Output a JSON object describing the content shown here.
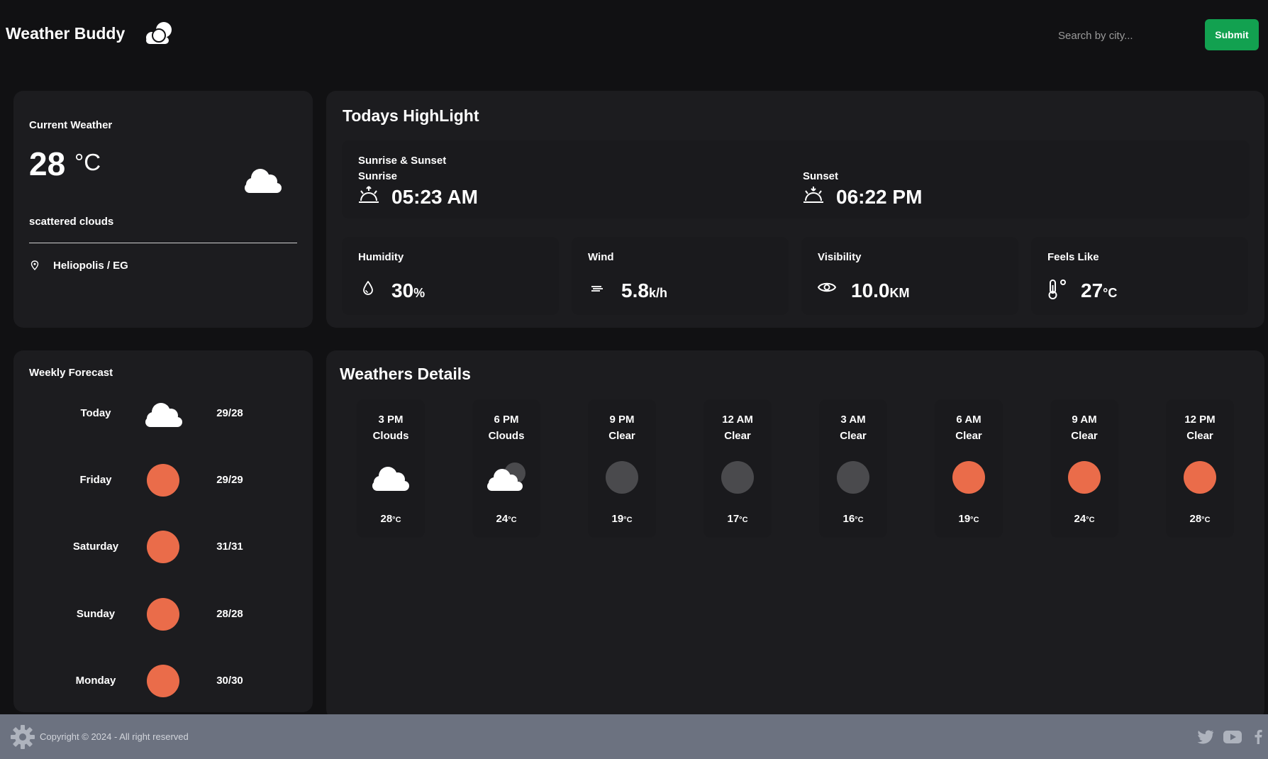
{
  "header": {
    "title": "Weather Buddy",
    "search_placeholder": "Search by city...",
    "search_value": "",
    "submit_label": "Submit"
  },
  "current": {
    "label": "Current Weather",
    "temp": "28",
    "unit": "°C",
    "description": "scattered clouds",
    "location": "Heliopolis / EG",
    "icon": "cloud-icon"
  },
  "highlights": {
    "title": "Todays HighLight",
    "sun_heading": "Sunrise & Sunset",
    "sunrise_label": "Sunrise",
    "sunrise_time": "05:23 AM",
    "sunset_label": "Sunset",
    "sunset_time": "06:22 PM",
    "humidity_label": "Humidity",
    "humidity_value": "30",
    "humidity_unit": "%",
    "wind_label": "Wind",
    "wind_value": "5.8",
    "wind_unit": "k/h",
    "visibility_label": "Visibility",
    "visibility_value": "10.0",
    "visibility_unit": "KM",
    "feels_label": "Feels Like",
    "feels_value": "27",
    "feels_unit": "°C"
  },
  "weekly": {
    "title": "Weekly Forecast",
    "days": [
      {
        "day": "Today",
        "temps": "29/28",
        "icon": "cloud-icon"
      },
      {
        "day": "Friday",
        "temps": "29/29",
        "icon": "sun-icon"
      },
      {
        "day": "Saturday",
        "temps": "31/31",
        "icon": "sun-icon"
      },
      {
        "day": "Sunday",
        "temps": "28/28",
        "icon": "sun-icon"
      },
      {
        "day": "Monday",
        "temps": "30/30",
        "icon": "sun-icon"
      }
    ]
  },
  "details": {
    "title": "Weathers Details",
    "hours": [
      {
        "time": "3 PM",
        "desc": "Clouds",
        "temp": "28",
        "unit": "°C",
        "icon": "cloud-icon"
      },
      {
        "time": "6 PM",
        "desc": "Clouds",
        "temp": "24",
        "unit": "°C",
        "icon": "cloud-moon-icon"
      },
      {
        "time": "9 PM",
        "desc": "Clear",
        "temp": "19",
        "unit": "°C",
        "icon": "moon-icon"
      },
      {
        "time": "12 AM",
        "desc": "Clear",
        "temp": "17",
        "unit": "°C",
        "icon": "moon-icon"
      },
      {
        "time": "3 AM",
        "desc": "Clear",
        "temp": "16",
        "unit": "°C",
        "icon": "moon-icon"
      },
      {
        "time": "6 AM",
        "desc": "Clear",
        "temp": "19",
        "unit": "°C",
        "icon": "sun-icon"
      },
      {
        "time": "9 AM",
        "desc": "Clear",
        "temp": "24",
        "unit": "°C",
        "icon": "sun-icon"
      },
      {
        "time": "12 PM",
        "desc": "Clear",
        "temp": "28",
        "unit": "°C",
        "icon": "sun-icon"
      }
    ]
  },
  "footer": {
    "copyright": "Copyright © 2024 - All right reserved",
    "icons": [
      "gear-icon",
      "twitter-icon",
      "youtube-icon",
      "facebook-icon"
    ]
  },
  "colors": {
    "background": "#111113",
    "card": "#1c1c1f",
    "accent": "#12a150",
    "sun": "#ea6c4a",
    "moon": "#4a4a4d",
    "footer": "#6c7280"
  }
}
